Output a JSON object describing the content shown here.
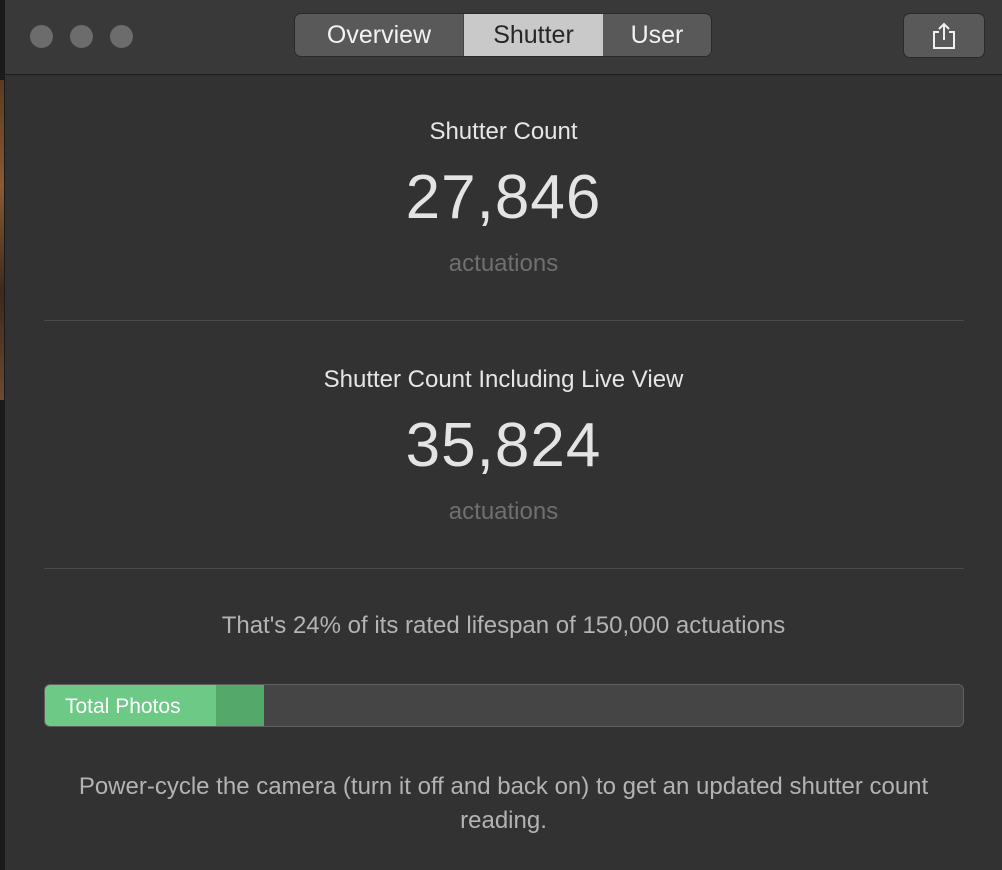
{
  "tabs": [
    {
      "label": "Overview",
      "selected": false
    },
    {
      "label": "Shutter",
      "selected": true
    },
    {
      "label": "User",
      "selected": false
    }
  ],
  "toolbar": {
    "share_icon": "share-icon"
  },
  "shutter_count": {
    "title": "Shutter Count",
    "value": "27,846",
    "unit": "actuations"
  },
  "shutter_count_live_view": {
    "title": "Shutter Count Including Live View",
    "value": "35,824",
    "unit": "actuations"
  },
  "lifespan_text": "That's 24% of its rated lifespan of 150,000 actuations",
  "progress": {
    "label": "Total Photos",
    "total_photos_fraction": 0.186,
    "live_view_fraction": 0.239,
    "color_total": "#6dca86",
    "color_live_view": "#53a86a"
  },
  "footer_note": "Power-cycle the camera (turn it off and back on) to get an updated shutter count reading.",
  "colors": {
    "background": "#323232",
    "selected_tab": "#c9c9c9",
    "traffic_light": "#6c6c6c"
  }
}
